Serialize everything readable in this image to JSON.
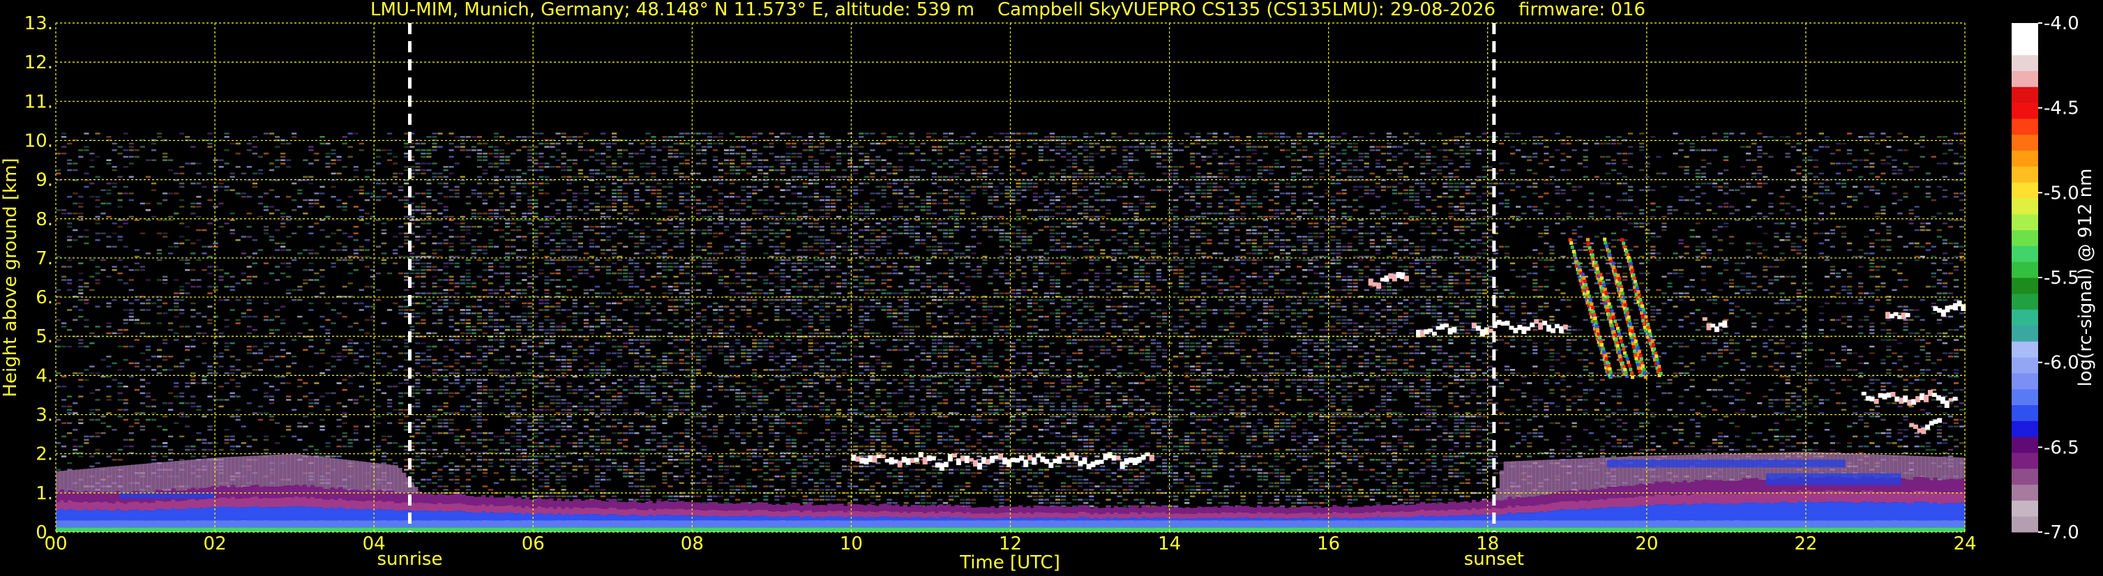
{
  "chart_data": {
    "type": "heatmap",
    "title": "LMU-MIM, Munich, Germany; 48.148° N 11.573° E, altitude: 539 m    Campbell SkyVUEPRO CS135 (CS135LMU): 29-08-2026    firmware: 016",
    "xlabel": "Time [UTC]",
    "ylabel": "Height above ground [km]",
    "xlim": [
      0,
      24
    ],
    "ylim": [
      0,
      13
    ],
    "x_ticks": [
      0,
      2,
      4,
      6,
      8,
      10,
      12,
      14,
      16,
      18,
      20,
      22,
      24
    ],
    "x_tick_labels": [
      "00",
      "02",
      "04",
      "06",
      "08",
      "10",
      "12",
      "14",
      "16",
      "18",
      "20",
      "22",
      "24"
    ],
    "y_ticks": [
      0,
      1,
      2,
      3,
      4,
      5,
      6,
      7,
      8,
      9,
      10,
      11,
      12,
      13
    ],
    "y_tick_labels": [
      "0.",
      "1.",
      "2.",
      "3.",
      "4.",
      "5.",
      "6.",
      "7.",
      "8.",
      "9.",
      "10.",
      "11.",
      "12.",
      "13."
    ],
    "grid": true,
    "grid_color": "#ffff00",
    "text_color": "#ffff33",
    "background": "#000000",
    "data_top_km": 10.2,
    "markers": [
      {
        "label": "sunrise",
        "x": 4.45
      },
      {
        "label": "sunset",
        "x": 18.08
      }
    ],
    "colorbar": {
      "label": "log(rc-signal) @ 912 nm",
      "range": [
        -7.0,
        -4.0
      ],
      "ticks": [
        -4.0,
        -4.5,
        -5.0,
        -5.5,
        -6.0,
        -6.5,
        -7.0
      ],
      "tick_labels": [
        "-4.0",
        "-4.5",
        "-5.0",
        "-5.5",
        "-6.0",
        "-6.5",
        "-7.0"
      ],
      "colors": [
        "#b39fb0",
        "#c6b6c4",
        "#a77aa0",
        "#8f4d8a",
        "#7a2080",
        "#5f0a75",
        "#1a1ae0",
        "#3050f0",
        "#5a7af5",
        "#7a90f5",
        "#93a6f5",
        "#a9bcf7",
        "#3aa8a0",
        "#30b890",
        "#20a040",
        "#1c8c1c",
        "#33c040",
        "#40d46a",
        "#6ee04a",
        "#aaf04a",
        "#e0f040",
        "#ffe030",
        "#ffbe20",
        "#ff9c10",
        "#ff7010",
        "#ff4010",
        "#f01010",
        "#e01010",
        "#f0b0b0",
        "#e8d4d4",
        "#ffffff",
        "#ffffff"
      ]
    },
    "layers": {
      "surface_layer": [
        {
          "x": 0,
          "top": 1.05
        },
        {
          "x": 1,
          "top": 1.0
        },
        {
          "x": 2,
          "top": 1.15
        },
        {
          "x": 3,
          "top": 1.2
        },
        {
          "x": 4,
          "top": 1.05
        },
        {
          "x": 6,
          "top": 0.85
        },
        {
          "x": 8,
          "top": 0.75
        },
        {
          "x": 10,
          "top": 0.7
        },
        {
          "x": 12,
          "top": 0.65
        },
        {
          "x": 14,
          "top": 0.65
        },
        {
          "x": 16,
          "top": 0.65
        },
        {
          "x": 18,
          "top": 0.8
        },
        {
          "x": 20,
          "top": 1.25
        },
        {
          "x": 22,
          "top": 1.4
        },
        {
          "x": 24,
          "top": 1.35
        }
      ],
      "residual_layer": [
        {
          "x": 0,
          "top": 1.55
        },
        {
          "x": 2,
          "top": 1.9
        },
        {
          "x": 3,
          "top": 2.0
        },
        {
          "x": 4.3,
          "top": 1.7
        },
        {
          "x": 5,
          "top": 0
        },
        {
          "x": 18,
          "top": 0
        },
        {
          "x": 18.2,
          "top": 1.8
        },
        {
          "x": 20,
          "top": 1.95
        },
        {
          "x": 22,
          "top": 2.05
        },
        {
          "x": 24,
          "top": 1.9
        }
      ],
      "clouds": [
        {
          "x0": 16.5,
          "x1": 17.0,
          "y": 6.5
        },
        {
          "x0": 17.1,
          "x1": 17.6,
          "y": 5.2
        },
        {
          "x0": 17.8,
          "x1": 19.0,
          "y": 5.3
        },
        {
          "x0": 20.7,
          "x1": 21.0,
          "y": 5.4
        },
        {
          "x0": 23.0,
          "x1": 23.3,
          "y": 5.6
        },
        {
          "x0": 23.6,
          "x1": 24.0,
          "y": 5.8
        },
        {
          "x0": 22.7,
          "x1": 23.9,
          "y": 3.5
        },
        {
          "x0": 23.3,
          "x1": 23.7,
          "y": 2.8
        },
        {
          "x0": 10.0,
          "x1": 13.8,
          "y": 1.9
        }
      ]
    }
  }
}
